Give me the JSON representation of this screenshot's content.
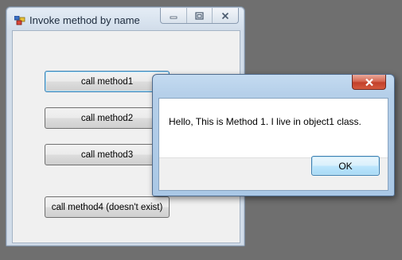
{
  "main_window": {
    "title": "Invoke method by name",
    "buttons": {
      "method1": "call method1",
      "method2": "call method2",
      "method3": "call method3",
      "method4": "call method4 (doesn't exist)"
    }
  },
  "message_box": {
    "text": "Hello, This is Method 1. I live in object1 class.",
    "ok_label": "OK"
  }
}
